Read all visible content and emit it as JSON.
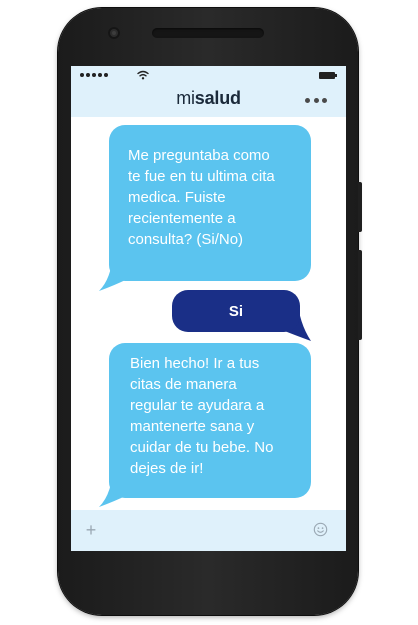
{
  "app": {
    "brand_prefix": "mi",
    "brand_main": "salud"
  },
  "conversation": {
    "messages": [
      {
        "from": "bot",
        "text": "Me preguntaba como\nte fue en tu ultima cita\nmedica.  Fuiste\nrecientemente a\nconsulta? (Si/No)"
      },
      {
        "from": "user",
        "text": "Si"
      },
      {
        "from": "bot",
        "text": "Bien hecho! Ir a tus\ncitas de manera\nregular te ayudara a\nmantenerte sana y\ncuidar de tu bebe. No\ndejes de ir!"
      }
    ]
  },
  "icons": {
    "status": [
      "signal-dots-icon",
      "wifi-icon",
      "battery-icon"
    ],
    "header": "more-options-icon",
    "input": [
      "plus-icon",
      "emoji-icon"
    ]
  },
  "colors": {
    "incoming_bubble": "#5bc4ef",
    "outgoing_bubble": "#1a2f87",
    "header_background": "#dff1fb",
    "phone_body": "#222222"
  }
}
